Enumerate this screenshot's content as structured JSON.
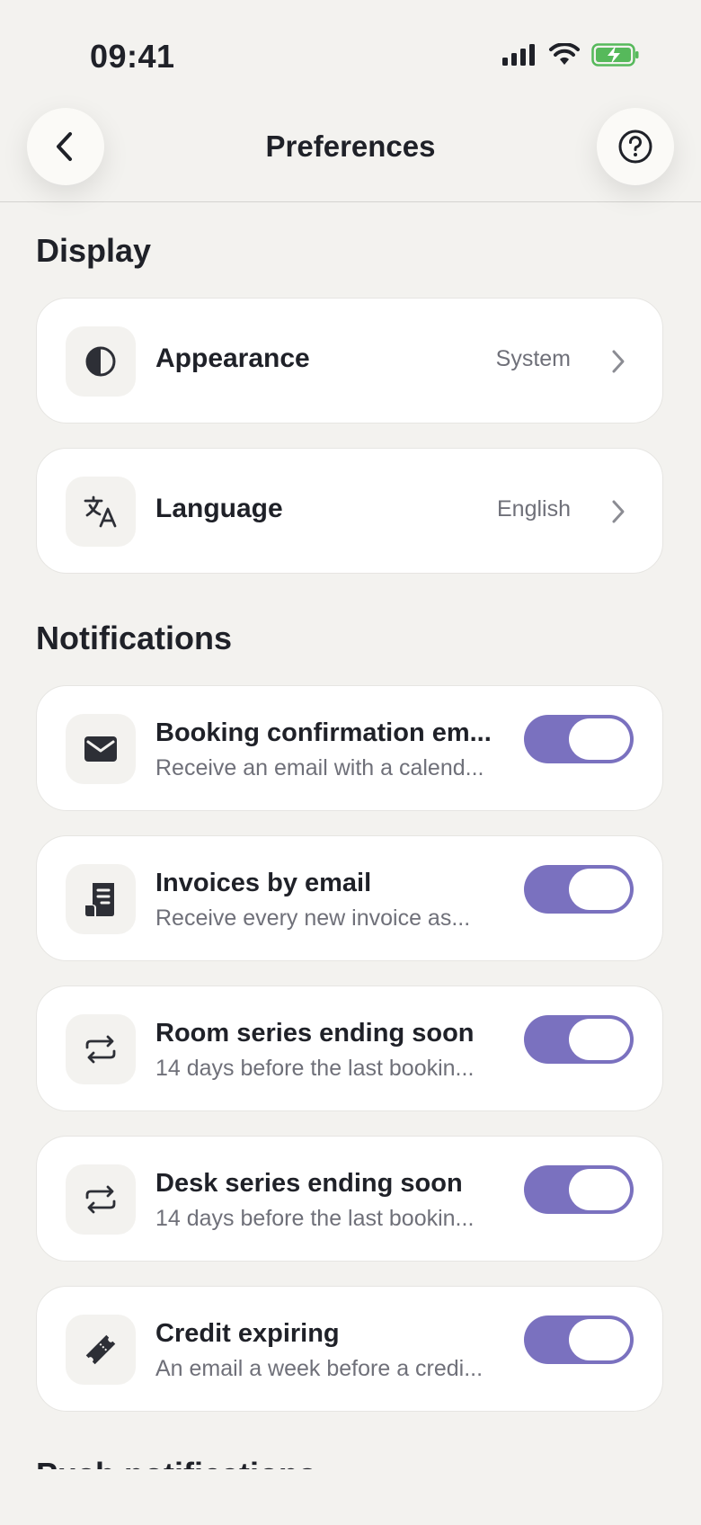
{
  "status_bar": {
    "time": "09:41"
  },
  "header": {
    "title": "Preferences"
  },
  "sections": {
    "display": {
      "title": "Display",
      "appearance": {
        "label": "Appearance",
        "value": "System"
      },
      "language": {
        "label": "Language",
        "value": "English"
      }
    },
    "notifications": {
      "title": "Notifications",
      "items": [
        {
          "title": "Booking confirmation em...",
          "subtitle": "Receive an email with a calend...",
          "enabled": true
        },
        {
          "title": "Invoices by email",
          "subtitle": "Receive every new invoice as...",
          "enabled": true
        },
        {
          "title": "Room series ending soon",
          "subtitle": "14 days before the last bookin...",
          "enabled": true
        },
        {
          "title": "Desk series ending soon",
          "subtitle": "14 days before the last bookin...",
          "enabled": true
        },
        {
          "title": "Credit expiring",
          "subtitle": "An email a week before a credi...",
          "enabled": true
        }
      ]
    },
    "next_partial": {
      "title": "Push notifications"
    }
  },
  "colors": {
    "accent": "#7a71bf",
    "background": "#f3f2ef",
    "card": "#ffffff"
  },
  "icons": [
    "signal-icon",
    "wifi-icon",
    "battery-icon",
    "back-arrow-icon",
    "help-icon",
    "contrast-icon",
    "translate-icon",
    "mail-icon",
    "invoice-icon",
    "repeat-icon",
    "ticket-icon",
    "chevron-right-icon"
  ]
}
